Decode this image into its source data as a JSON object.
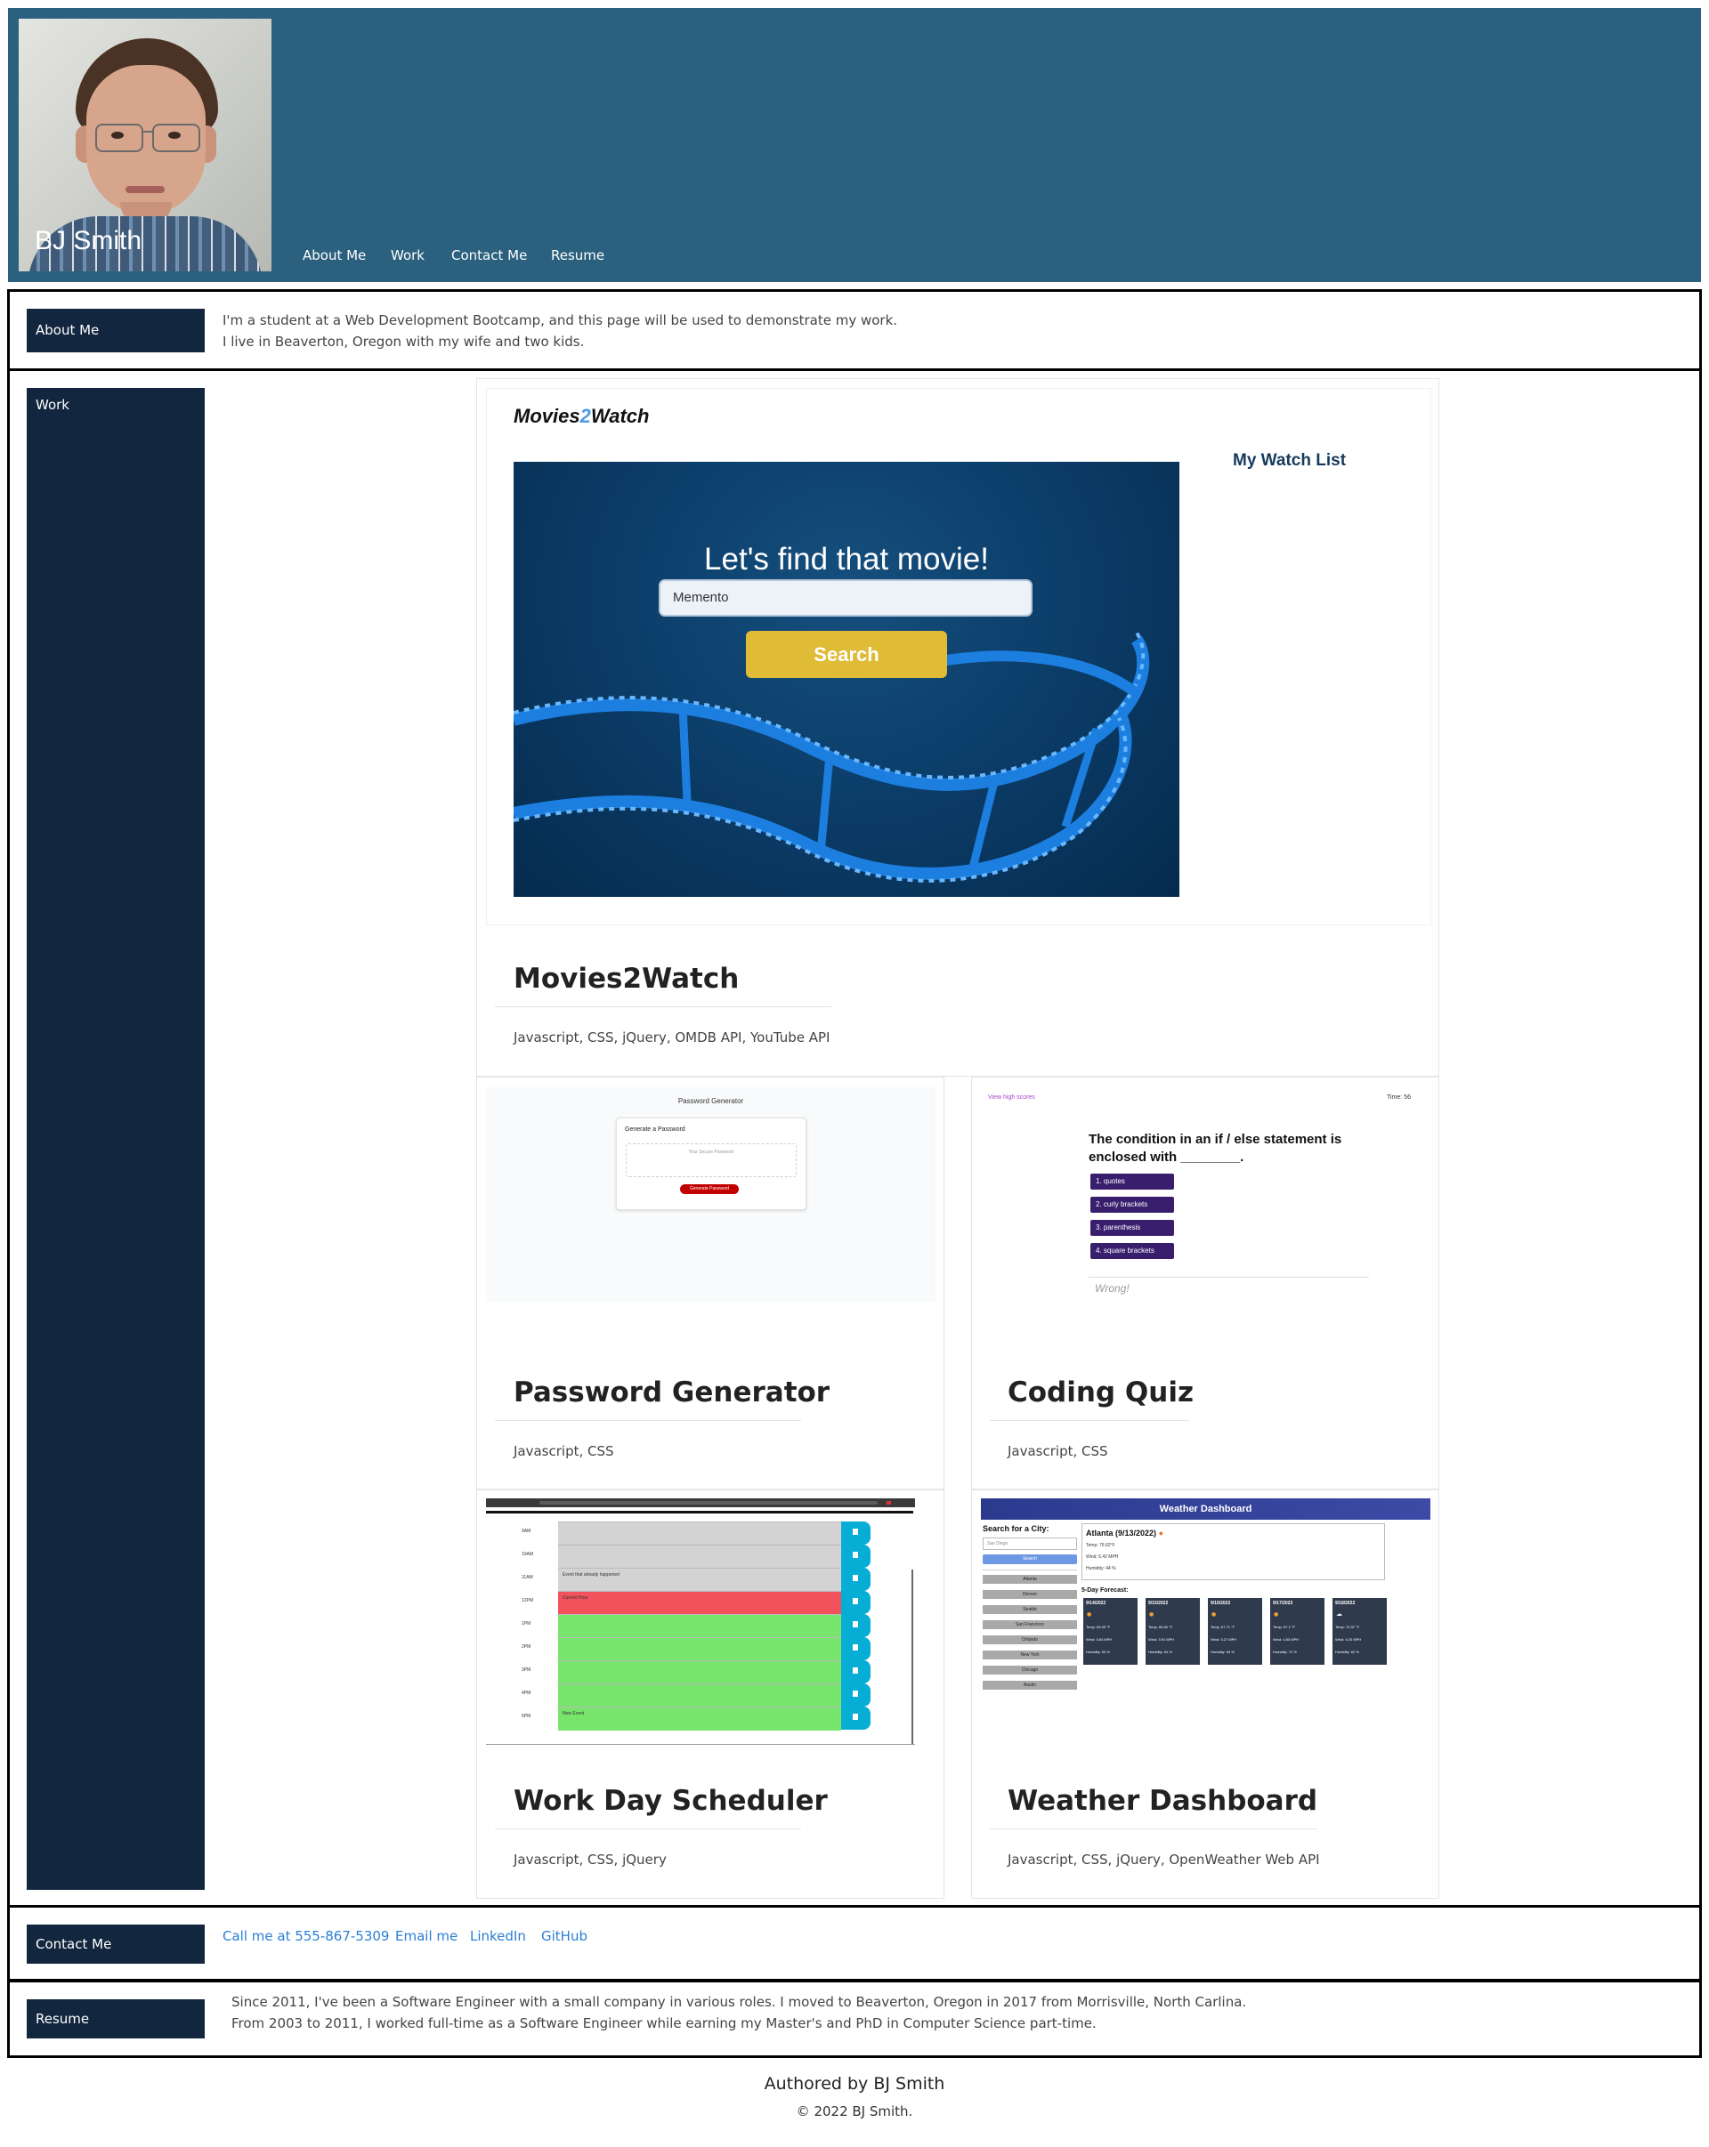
{
  "header": {
    "site_title": "BJ Smith",
    "nav": [
      {
        "label": "About Me"
      },
      {
        "label": "Work"
      },
      {
        "label": "Contact Me"
      },
      {
        "label": "Resume"
      }
    ]
  },
  "about": {
    "label": "About Me",
    "lines": [
      "I'm a student at a Web Development Bootcamp, and this page will be used to demonstrate my work.",
      "I live in Beaverton, Oregon with my wife and two kids."
    ]
  },
  "work": {
    "label": "Work",
    "featured": {
      "title": "Movies2Watch",
      "tech": "Javascript, CSS, jQuery, OMDB API, YouTube API",
      "shot": {
        "logo_a": "Movies",
        "logo_b": "2",
        "logo_c": "Watch",
        "watch_list": "My Watch List",
        "headline": "Let's find that movie!",
        "input_value": "Memento",
        "button": "Search"
      }
    },
    "projects": [
      {
        "title": "Password Generator",
        "tech": "Javascript, CSS",
        "shot": {
          "heading": "Password Generator",
          "card_title": "Generate a Password",
          "placeholder": "Your Secure Password",
          "button": "Generate Password"
        }
      },
      {
        "title": "Coding Quiz",
        "tech": "Javascript, CSS",
        "shot": {
          "high_scores": "View high scores",
          "timer": "Time: 56",
          "question_l1": "The condition in an if / else statement is",
          "question_l2": "enclosed with ________.",
          "answers": [
            "1. quotes",
            "2. curly brackets",
            "3. parenthesis",
            "4. square brackets"
          ],
          "feedback": "Wrong!"
        }
      },
      {
        "title": "Work Day Scheduler",
        "tech": "Javascript, CSS, jQuery",
        "shot": {
          "hours": [
            "9AM",
            "10AM",
            "11AM",
            "12PM",
            "1PM",
            "2PM",
            "3PM",
            "4PM",
            "5PM"
          ],
          "events": [
            "",
            "",
            "Event that already happened",
            "Current Hour",
            "",
            "",
            "",
            "",
            "New Event"
          ]
        }
      },
      {
        "title": "Weather Dashboard",
        "tech": "Javascript, CSS, jQuery, OpenWeather Web API",
        "shot": {
          "banner": "Weather Dashboard",
          "search_label": "Search for a City:",
          "input_placeholder": "San Diego",
          "search_btn": "Search",
          "cities": [
            "Atlanta",
            "Denver",
            "Seattle",
            "San Francisco",
            "Orlando",
            "New York",
            "Chicago",
            "Austin"
          ],
          "current_title": "Atlanta (9/13/2022)",
          "current_lines": [
            "Temp: 76.62°F",
            "Wind: 5.42 MPH",
            "Humidity: 44 %"
          ],
          "forecast_label": "5-Day Forecast:",
          "forecast": [
            {
              "date": "9/14/2022",
              "temp": "Temp: 63.05 °F",
              "wind": "Wind: 3.84 MPH",
              "hum": "Humidity: 63 %"
            },
            {
              "date": "9/15/2022",
              "temp": "Temp: 66.62 °F",
              "wind": "Wind: 3.91 MPH",
              "hum": "Humidity: 64 %"
            },
            {
              "date": "9/16/2022",
              "temp": "Temp: 67.71 °F",
              "wind": "Wind: 3.27 MPH",
              "hum": "Humidity: 64 %"
            },
            {
              "date": "9/17/2022",
              "temp": "Temp: 67.1 °F",
              "wind": "Wind: 4.83 MPH",
              "hum": "Humidity: 72 %"
            },
            {
              "date": "9/18/2022",
              "temp": "Temp: 70.37 °F",
              "wind": "Wind: 4.23 MPH",
              "hum": "Humidity: 62 %"
            }
          ]
        }
      }
    ]
  },
  "contact": {
    "label": "Contact Me",
    "links": [
      "Call me at 555-867-5309",
      "Email me",
      "LinkedIn",
      "GitHub"
    ]
  },
  "resume": {
    "label": "Resume",
    "lines": [
      "Since 2011, I've been a Software Engineer with a small company in various roles. I moved to Beaverton, Oregon in 2017 from Morrisville, North Carlina.",
      "From 2003 to 2011, I worked full-time as a Software Engineer while earning my Master's and PhD in Computer Science part-time."
    ]
  },
  "footer": {
    "authored": "Authored by BJ Smith",
    "copyright": "© 2022 BJ Smith."
  },
  "colors": {
    "header_bg": "#2b617e",
    "label_bg": "#13263f",
    "link": "#2a7fd4",
    "search_btn": "#e0bb36"
  }
}
